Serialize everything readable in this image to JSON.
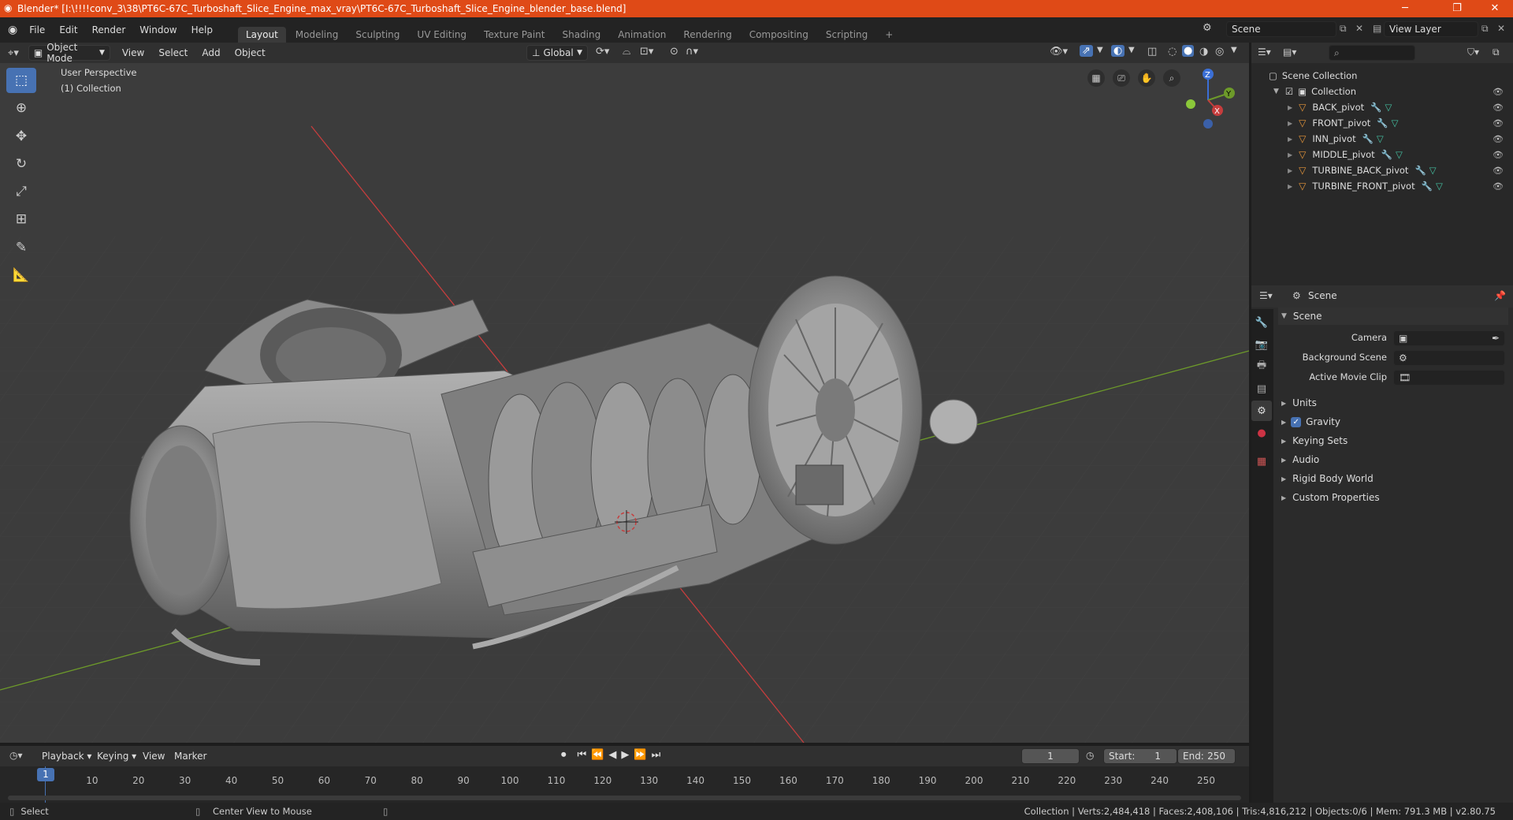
{
  "titlebar": {
    "title": "Blender* [I:\\!!!!conv_3\\38\\PT6C-67C_Turboshaft_Slice_Engine_max_vray\\PT6C-67C_Turboshaft_Slice_Engine_blender_base.blend]",
    "minimize": "─",
    "restore": "❐",
    "close": "✕"
  },
  "menubar": {
    "items": [
      "File",
      "Edit",
      "Render",
      "Window",
      "Help"
    ]
  },
  "workspaces": {
    "tabs": [
      "Layout",
      "Modeling",
      "Sculpting",
      "UV Editing",
      "Texture Paint",
      "Shading",
      "Animation",
      "Rendering",
      "Compositing",
      "Scripting"
    ],
    "active": "Layout",
    "add": "+"
  },
  "scene_selector": {
    "value": "Scene"
  },
  "view_layer_selector": {
    "value": "View Layer"
  },
  "viewport_header": {
    "mode": "Object Mode",
    "menus": [
      "View",
      "Select",
      "Add",
      "Object"
    ],
    "orientation": "Global"
  },
  "viewport": {
    "view_name": "User Perspective",
    "collection_label": "(1) Collection",
    "gizmo_axes": {
      "x": "X",
      "y": "Y",
      "z": "Z"
    }
  },
  "outliner": {
    "search_placeholder": "",
    "root": "Scene Collection",
    "collection": "Collection",
    "objects": [
      "BACK_pivot",
      "FRONT_pivot",
      "INN_pivot",
      "MIDDLE_pivot",
      "TURBINE_BACK_pivot",
      "TURBINE_FRONT_pivot"
    ]
  },
  "properties": {
    "header": "Scene",
    "panel_title": "Scene",
    "fields": {
      "camera_label": "Camera",
      "background_scene_label": "Background Scene",
      "active_movie_clip_label": "Active Movie Clip"
    },
    "sections": [
      "Units",
      "Gravity",
      "Keying Sets",
      "Audio",
      "Rigid Body World",
      "Custom Properties"
    ],
    "gravity_checked": true
  },
  "timeline": {
    "menus": [
      "Playback",
      "Keying",
      "View",
      "Marker"
    ],
    "current_frame": "1",
    "start_label": "Start:",
    "start_value": "1",
    "end_label": "End:",
    "end_value": "250",
    "ruler_current": "1",
    "ticks": [
      "10",
      "20",
      "30",
      "40",
      "50",
      "60",
      "70",
      "80",
      "90",
      "100",
      "110",
      "120",
      "130",
      "140",
      "150",
      "160",
      "170",
      "180",
      "190",
      "200",
      "210",
      "220",
      "230",
      "240",
      "250"
    ]
  },
  "statusbar": {
    "select": "Select",
    "center_view": "Center View to Mouse",
    "stats": "Collection | Verts:2,484,418 | Faces:2,408,106 | Tris:4,816,212 | Objects:0/6 | Mem: 791.3 MB | v2.80.75"
  },
  "colors": {
    "title_bar": "#df4a17",
    "accent_blue": "#4772b3",
    "viewport_bg": "#3c3c3c",
    "axis_x": "#c63d3d",
    "axis_y": "#6d9a2a"
  }
}
